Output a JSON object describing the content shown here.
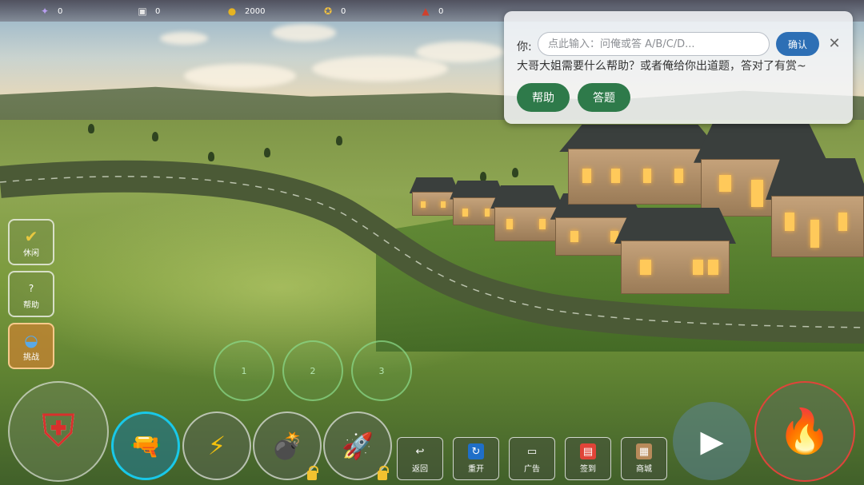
{
  "topbar": {
    "stats": [
      {
        "icon": "purple-gem-icon",
        "glyph": "✦",
        "color": "#7b5cc4",
        "value": "0"
      },
      {
        "icon": "tv-box-icon",
        "glyph": "▣",
        "color": "#4b4f5a",
        "value": "0"
      },
      {
        "icon": "gold-coin-icon",
        "glyph": "●",
        "color": "#e6b422",
        "value": "2000"
      },
      {
        "icon": "medal-icon",
        "glyph": "✪",
        "color": "#3a78d0",
        "value": "0"
      },
      {
        "icon": "flask-icon",
        "glyph": "▲",
        "color": "#d0402c",
        "value": "0"
      }
    ]
  },
  "dialog": {
    "label": "你:",
    "input_placeholder": "点此输入：问俺或答 A/B/C/D...",
    "input_value": "",
    "confirm_label": "确认",
    "close_glyph": "✕",
    "message": "大哥大姐需要什么帮助？或者俺给你出道题，答对了有赏~",
    "help_label": "帮助",
    "quiz_label": "答题"
  },
  "side": {
    "items": [
      {
        "label": "休闲",
        "glyph": "✔",
        "color": "#e8c840"
      },
      {
        "label": "帮助",
        "glyph": "?",
        "color": "#ffffff"
      },
      {
        "label": "挑战",
        "glyph": "◒",
        "color": "#59a9e8"
      }
    ]
  },
  "slots": [
    "1",
    "2",
    "3"
  ],
  "skills": {
    "shield_glyph": "⛨",
    "water_gun_glyph": "🔫",
    "lightning_glyph": "⚡",
    "bomb_glyph": "💣",
    "rocket_glyph": "🚀"
  },
  "menu": [
    {
      "label": "返回",
      "glyph": "↩",
      "color": "transparent"
    },
    {
      "label": "重开",
      "glyph": "↻",
      "color": "#1f6fc8"
    },
    {
      "label": "广告",
      "glyph": "▭",
      "color": "transparent"
    },
    {
      "label": "签到",
      "glyph": "▤",
      "color": "#e04438"
    },
    {
      "label": "商城",
      "glyph": "▦",
      "color": "#b88a5a"
    }
  ],
  "controls": {
    "play_glyph": "▶",
    "fire_glyph": "🔥"
  },
  "colors": {
    "road": "#4b5a36",
    "dialog_confirm": "#2d6fb5",
    "dialog_button": "#2e7a4a",
    "fire_ring": "#e0443a",
    "skill_ring_active": "#19c8e8"
  }
}
